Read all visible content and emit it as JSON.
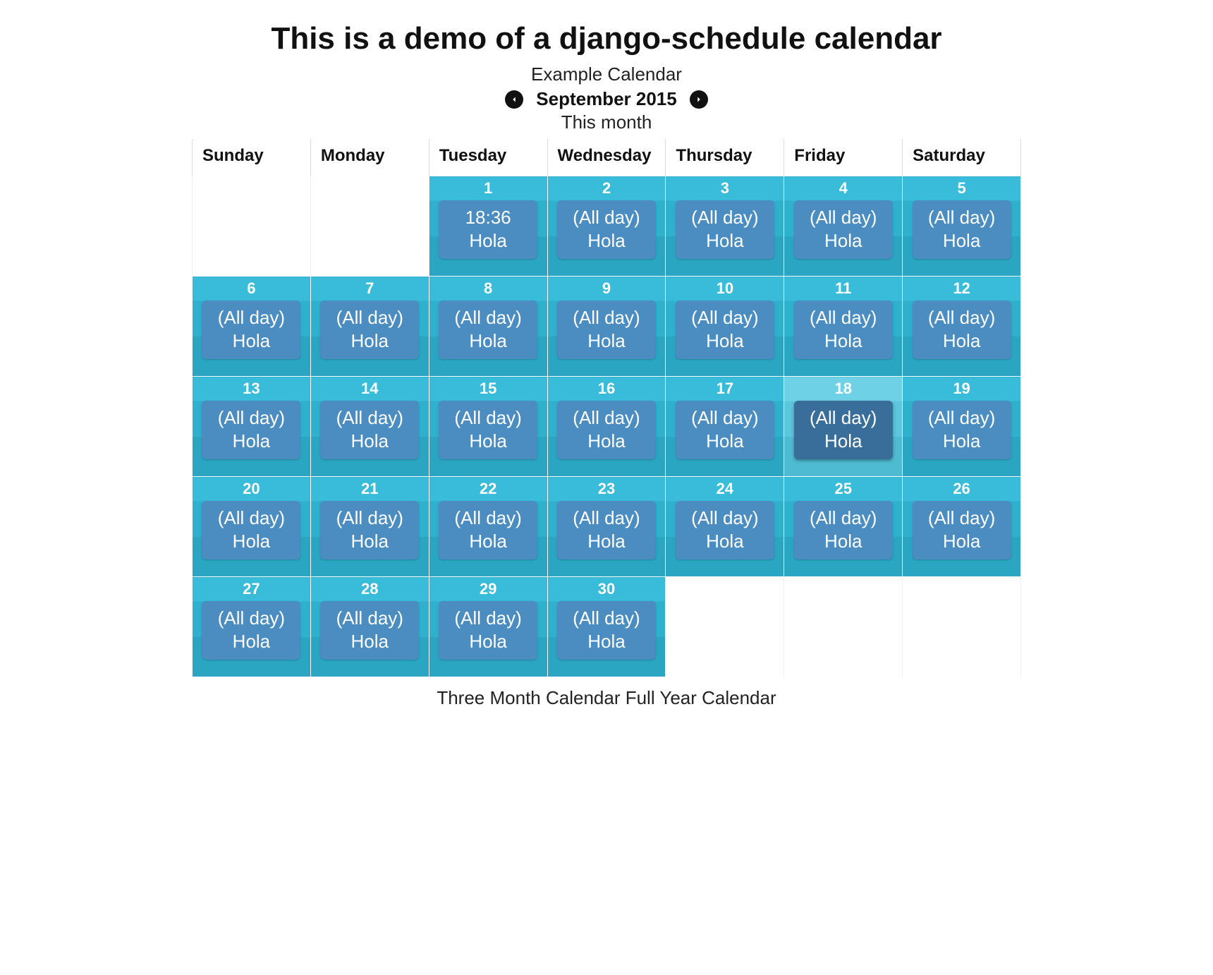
{
  "header": {
    "title": "This is a demo of a django-schedule calendar",
    "calendar_name": "Example Calendar",
    "month_label": "September 2015",
    "this_month": "This month"
  },
  "weekdays": [
    "Sunday",
    "Monday",
    "Tuesday",
    "Wednesday",
    "Thursday",
    "Friday",
    "Saturday"
  ],
  "weeks": [
    [
      {
        "blank": true
      },
      {
        "blank": true
      },
      {
        "day": "1",
        "today": false,
        "event": {
          "time": "18:36",
          "title": "Hola"
        }
      },
      {
        "day": "2",
        "today": false,
        "event": {
          "time": "(All day)",
          "title": "Hola"
        }
      },
      {
        "day": "3",
        "today": false,
        "event": {
          "time": "(All day)",
          "title": "Hola"
        }
      },
      {
        "day": "4",
        "today": false,
        "event": {
          "time": "(All day)",
          "title": "Hola"
        }
      },
      {
        "day": "5",
        "today": false,
        "event": {
          "time": "(All day)",
          "title": "Hola"
        }
      }
    ],
    [
      {
        "day": "6",
        "today": false,
        "event": {
          "time": "(All day)",
          "title": "Hola"
        }
      },
      {
        "day": "7",
        "today": false,
        "event": {
          "time": "(All day)",
          "title": "Hola"
        }
      },
      {
        "day": "8",
        "today": false,
        "event": {
          "time": "(All day)",
          "title": "Hola"
        }
      },
      {
        "day": "9",
        "today": false,
        "event": {
          "time": "(All day)",
          "title": "Hola"
        }
      },
      {
        "day": "10",
        "today": false,
        "event": {
          "time": "(All day)",
          "title": "Hola"
        }
      },
      {
        "day": "11",
        "today": false,
        "event": {
          "time": "(All day)",
          "title": "Hola"
        }
      },
      {
        "day": "12",
        "today": false,
        "event": {
          "time": "(All day)",
          "title": "Hola"
        }
      }
    ],
    [
      {
        "day": "13",
        "today": false,
        "event": {
          "time": "(All day)",
          "title": "Hola"
        }
      },
      {
        "day": "14",
        "today": false,
        "event": {
          "time": "(All day)",
          "title": "Hola"
        }
      },
      {
        "day": "15",
        "today": false,
        "event": {
          "time": "(All day)",
          "title": "Hola"
        }
      },
      {
        "day": "16",
        "today": false,
        "event": {
          "time": "(All day)",
          "title": "Hola"
        }
      },
      {
        "day": "17",
        "today": false,
        "event": {
          "time": "(All day)",
          "title": "Hola"
        }
      },
      {
        "day": "18",
        "today": true,
        "event": {
          "time": "(All day)",
          "title": "Hola"
        }
      },
      {
        "day": "19",
        "today": false,
        "event": {
          "time": "(All day)",
          "title": "Hola"
        }
      }
    ],
    [
      {
        "day": "20",
        "today": false,
        "event": {
          "time": "(All day)",
          "title": "Hola"
        }
      },
      {
        "day": "21",
        "today": false,
        "event": {
          "time": "(All day)",
          "title": "Hola"
        }
      },
      {
        "day": "22",
        "today": false,
        "event": {
          "time": "(All day)",
          "title": "Hola"
        }
      },
      {
        "day": "23",
        "today": false,
        "event": {
          "time": "(All day)",
          "title": "Hola"
        }
      },
      {
        "day": "24",
        "today": false,
        "event": {
          "time": "(All day)",
          "title": "Hola"
        }
      },
      {
        "day": "25",
        "today": false,
        "event": {
          "time": "(All day)",
          "title": "Hola"
        }
      },
      {
        "day": "26",
        "today": false,
        "event": {
          "time": "(All day)",
          "title": "Hola"
        }
      }
    ],
    [
      {
        "day": "27",
        "today": false,
        "event": {
          "time": "(All day)",
          "title": "Hola"
        }
      },
      {
        "day": "28",
        "today": false,
        "event": {
          "time": "(All day)",
          "title": "Hola"
        }
      },
      {
        "day": "29",
        "today": false,
        "event": {
          "time": "(All day)",
          "title": "Hola"
        }
      },
      {
        "day": "30",
        "today": false,
        "event": {
          "time": "(All day)",
          "title": "Hola"
        }
      },
      {
        "blank": true
      },
      {
        "blank": true
      },
      {
        "blank": true
      }
    ]
  ],
  "footer": {
    "three_month": "Three Month Calendar",
    "full_year": "Full Year Calendar"
  }
}
